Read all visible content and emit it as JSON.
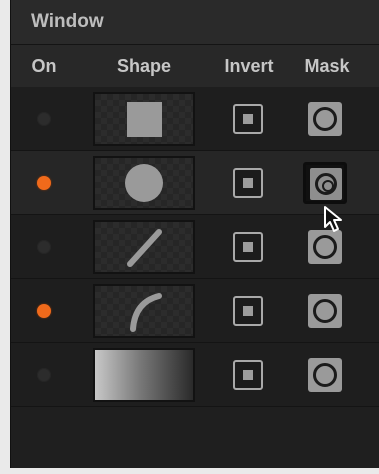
{
  "window": {
    "title": "Window",
    "columns": {
      "on": "On",
      "shape": "Shape",
      "invert": "Invert",
      "mask": "Mask"
    },
    "rows": [
      {
        "on": false,
        "shape": "rectangle-shape-icon",
        "mask_active": false
      },
      {
        "on": true,
        "shape": "circle-shape-icon",
        "mask_active": true
      },
      {
        "on": false,
        "shape": "line-shape-icon",
        "mask_active": false
      },
      {
        "on": true,
        "shape": "curve-shape-icon",
        "mask_active": false
      },
      {
        "on": false,
        "shape": "gradient-shape-icon",
        "mask_active": false
      }
    ]
  },
  "colors": {
    "panel_bg": "#1f1f1f",
    "on_active": "#f06a1b",
    "on_inactive": "#2c2c2c",
    "shape_fill": "#9a9a9a"
  }
}
